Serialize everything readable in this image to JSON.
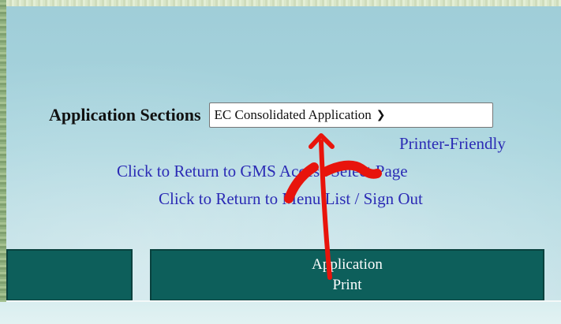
{
  "sections": {
    "label": "Application Sections",
    "selected_value": "EC Consolidated Application"
  },
  "links": {
    "printer_friendly": "Printer-Friendly",
    "return_gms": "Click to Return to GMS Access/Select Page",
    "return_menu": "Click to Return to Menu List / Sign Out"
  },
  "buttons": {
    "print_line1": "Application",
    "print_line2": "Print"
  },
  "colors": {
    "link": "#2b2bb5",
    "button_bg": "#0d5f5b",
    "annotation": "#e8140c"
  },
  "icons": {
    "dropdown": "chevron-down-icon",
    "annotation": "red-arrow-annotation"
  }
}
